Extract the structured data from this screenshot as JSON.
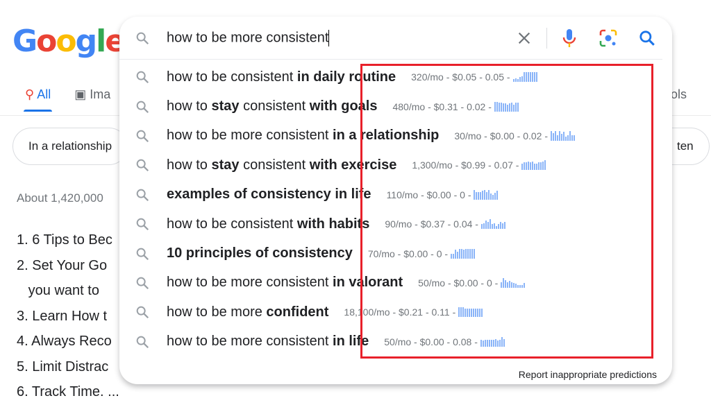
{
  "logo": "Google",
  "tabs": {
    "all": "All",
    "images": "Ima",
    "tools": "ols"
  },
  "chips": [
    "In a relationship",
    "ten"
  ],
  "results_stats": "About 1,420,000",
  "list": [
    "1. 6 Tips to Bec",
    "2. Set Your Go",
    "   you want to",
    "3. Learn How t",
    "4. Always Reco",
    "5. Limit Distrac",
    "6. Track Time. ..."
  ],
  "search": {
    "query": "how to be more consistent",
    "icons": [
      "search-icon",
      "clear-icon",
      "microphone-icon",
      "lens-icon",
      "search-icon"
    ]
  },
  "suggestions": [
    {
      "parts": [
        [
          "how to be consistent ",
          0
        ],
        [
          "in daily routine",
          1
        ]
      ],
      "meta": "320/mo - $0.05 - 0.05 -",
      "trend": [
        3,
        4,
        3,
        5,
        6,
        10,
        10,
        10,
        10,
        10,
        10,
        10
      ]
    },
    {
      "parts": [
        [
          "how to ",
          0
        ],
        [
          "stay",
          1
        ],
        [
          " consistent ",
          0
        ],
        [
          "with goals",
          1
        ]
      ],
      "meta": "480/mo - $0.31 - 0.02 -",
      "trend": [
        10,
        10,
        9,
        9,
        8,
        8,
        7,
        8,
        9,
        7,
        9,
        9
      ]
    },
    {
      "parts": [
        [
          "how to be more consistent ",
          0
        ],
        [
          "in a relationship",
          1
        ]
      ],
      "meta": "30/mo - $0.00 - 0.02 -",
      "trend": [
        10,
        8,
        10,
        6,
        10,
        7,
        9,
        4,
        6,
        10,
        6,
        6
      ]
    },
    {
      "parts": [
        [
          "how to ",
          0
        ],
        [
          "stay",
          1
        ],
        [
          " consistent ",
          0
        ],
        [
          "with exercise",
          1
        ]
      ],
      "meta": "1,300/mo - $0.99 - 0.07 -",
      "trend": [
        7,
        8,
        8,
        9,
        8,
        9,
        7,
        7,
        8,
        8,
        9,
        10
      ]
    },
    {
      "parts": [
        [
          "examples of consistency in life",
          1
        ]
      ],
      "meta": "110/mo - $0.00 - 0 -",
      "trend": [
        10,
        8,
        8,
        8,
        9,
        10,
        8,
        10,
        6,
        5,
        7,
        9
      ]
    },
    {
      "parts": [
        [
          "how to be consistent ",
          0
        ],
        [
          "with habits",
          1
        ]
      ],
      "meta": "90/mo - $0.37 - 0.04 -",
      "trend": [
        5,
        6,
        9,
        7,
        10,
        5,
        6,
        3,
        5,
        7,
        6,
        7
      ]
    },
    {
      "parts": [
        [
          "10 principles of consistency",
          1
        ]
      ],
      "meta": "70/mo - $0.00 - 0 -",
      "trend": [
        5,
        5,
        9,
        7,
        10,
        10,
        9,
        10,
        10,
        10,
        10,
        10
      ]
    },
    {
      "parts": [
        [
          "how to be more consistent ",
          0
        ],
        [
          "in valorant",
          1
        ]
      ],
      "meta": "50/mo - $0.00 - 0 -",
      "trend": [
        6,
        10,
        8,
        6,
        7,
        6,
        5,
        4,
        3,
        3,
        3,
        5
      ]
    },
    {
      "parts": [
        [
          "how to be more ",
          0
        ],
        [
          "confident",
          1
        ]
      ],
      "meta": "18,100/mo - $0.21 - 0.11 -",
      "trend": [
        10,
        10,
        10,
        9,
        9,
        9,
        9,
        9,
        9,
        9,
        9,
        9
      ]
    },
    {
      "parts": [
        [
          "how to be more consistent ",
          0
        ],
        [
          "in life",
          1
        ]
      ],
      "meta": "50/mo - $0.00 - 0.08 -",
      "trend": [
        7,
        6,
        7,
        7,
        7,
        7,
        7,
        8,
        6,
        7,
        10,
        8
      ]
    }
  ],
  "report": "Report inappropriate predictions",
  "colors": {
    "highlight_box": "#e8202a",
    "sparkline": "#8ab4f8",
    "accent": "#1a73e8"
  }
}
